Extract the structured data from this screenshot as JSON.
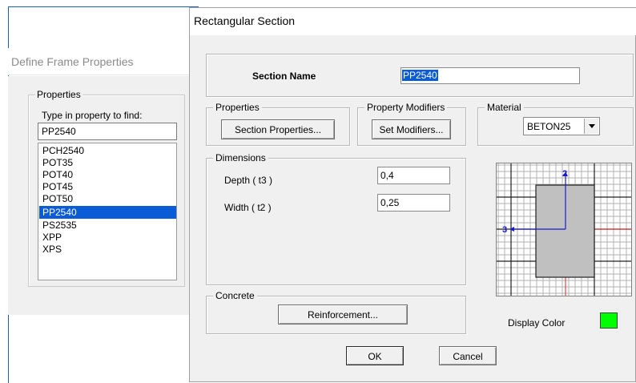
{
  "define_frame": {
    "title": "Define Frame Properties",
    "properties_legend": "Properties",
    "find_label": "Type in property to find:",
    "find_value": "PP2540",
    "items": [
      "PCH2540",
      "POT35",
      "POT40",
      "POT45",
      "POT50",
      "PP2540",
      "PS2535",
      "XPP",
      "XPS"
    ],
    "selected_index": 5
  },
  "dialog": {
    "title": "Rectangular Section",
    "section_name_label": "Section Name",
    "section_name_value": "PP2540",
    "properties_legend": "Properties",
    "section_properties_button": "Section Properties...",
    "modifiers_legend": "Property Modifiers",
    "set_modifiers_button": "Set Modifiers...",
    "material_legend": "Material",
    "material_value": "BETON25",
    "dimensions_legend": "Dimensions",
    "depth_label": "Depth  ( t3 )",
    "depth_value": "0,4",
    "width_label": "Width  ( t2 )",
    "width_value": "0,25",
    "concrete_legend": "Concrete",
    "reinforcement_button": "Reinforcement...",
    "display_color_label": "Display Color",
    "display_color": "#00ff00",
    "ok_button": "OK",
    "cancel_button": "Cancel",
    "axis_2_label": "2",
    "axis_3_label": "3"
  },
  "colors": {
    "selection": "#0a5bd6",
    "axis_arrow": "#1a1ad0",
    "axis_red": "#e02020",
    "section_fill": "#c0c0c0"
  }
}
